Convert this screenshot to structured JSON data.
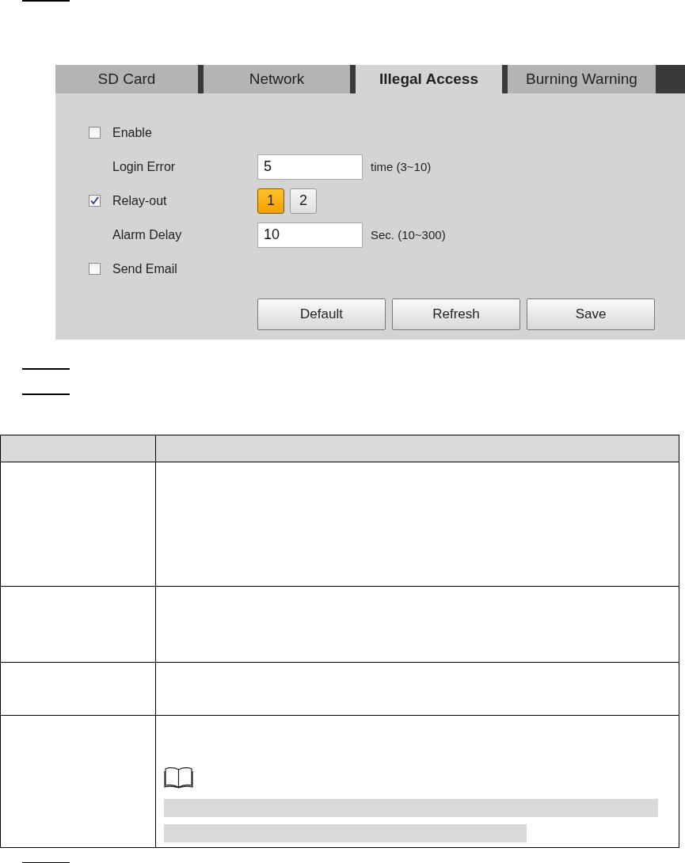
{
  "tabs": [
    {
      "label": "SD Card",
      "selected": false
    },
    {
      "label": "Network",
      "selected": false
    },
    {
      "label": "Illegal Access",
      "selected": true
    },
    {
      "label": "Burning Warning",
      "selected": false
    }
  ],
  "fields": [
    {
      "kind": "checkbox",
      "label": "Enable",
      "checked": false
    },
    {
      "kind": "input",
      "label": "Login Error",
      "value": "5",
      "hint": "time (3~10)"
    },
    {
      "kind": "relay",
      "label": "Relay-out",
      "checked": true,
      "channels": [
        {
          "label": "1",
          "selected": true
        },
        {
          "label": "2",
          "selected": false
        }
      ]
    },
    {
      "kind": "input",
      "label": "Alarm Delay",
      "value": "10",
      "hint": "Sec. (10~300)"
    },
    {
      "kind": "checkbox",
      "label": "Send Email",
      "checked": false
    }
  ],
  "buttons": [
    "Default",
    "Refresh",
    "Save"
  ]
}
